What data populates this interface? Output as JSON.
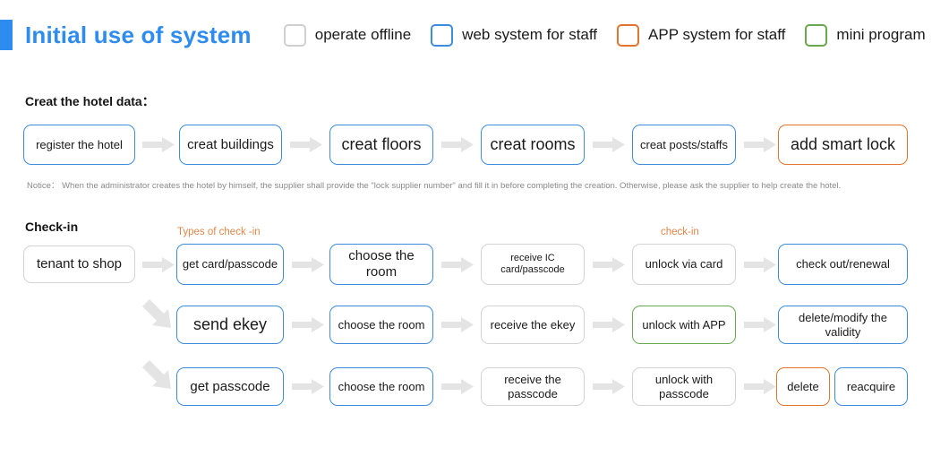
{
  "header": {
    "title": "Initial use of system",
    "accent_color": "#2e8cf0",
    "legend": [
      {
        "label": "operate offline",
        "color": "#cfcfcf",
        "style": "gray"
      },
      {
        "label": "web system for staff",
        "color": "#3d8ddf",
        "style": "blue"
      },
      {
        "label": "APP system for staff",
        "color": "#e2752e",
        "style": "orange"
      },
      {
        "label": "mini program",
        "color": "#6aa84f",
        "style": "green"
      }
    ]
  },
  "sections": {
    "hotel_data": {
      "heading": "Creat the hotel data：",
      "nodes": [
        {
          "label": "register the hotel",
          "style": "blue"
        },
        {
          "label": "creat buildings",
          "style": "blue"
        },
        {
          "label": "creat floors",
          "style": "blue"
        },
        {
          "label": "creat rooms",
          "style": "blue"
        },
        {
          "label": "creat posts/staffs",
          "style": "blue"
        },
        {
          "label": "add smart lock",
          "style": "orange"
        }
      ],
      "notice": "Notice：  When the administrator creates the hotel by himself, the supplier shall provide the \"lock supplier number\" and fill it in before completing the creation. Otherwise, please ask the supplier to help create the hotel."
    },
    "check_in": {
      "heading": "Check-in",
      "captions": {
        "types": "Types of check -in",
        "checkin": "check-in"
      },
      "start_node": {
        "label": "tenant to shop",
        "style": "gray"
      },
      "rows": [
        {
          "nodes": [
            {
              "label": "get card/passcode",
              "style": "blue"
            },
            {
              "label": "choose the room",
              "style": "blue"
            },
            {
              "label": "receive IC card/passcode",
              "style": "gray"
            },
            {
              "label": "unlock via card",
              "style": "gray"
            },
            {
              "label": "check out/renewal",
              "style": "blue"
            }
          ]
        },
        {
          "nodes": [
            {
              "label": "send ekey",
              "style": "blue"
            },
            {
              "label": "choose the room",
              "style": "blue"
            },
            {
              "label": "receive the ekey",
              "style": "gray"
            },
            {
              "label": "unlock with APP",
              "style": "green"
            },
            {
              "label": "delete/modify the validity",
              "style": "blue"
            }
          ]
        },
        {
          "nodes": [
            {
              "label": "get passcode",
              "style": "blue"
            },
            {
              "label": "choose the room",
              "style": "blue"
            },
            {
              "label": "receive the passcode",
              "style": "gray"
            },
            {
              "label": "unlock with passcode",
              "style": "gray"
            },
            {
              "label": "delete",
              "style": "orange"
            },
            {
              "label": "reacquire",
              "style": "blue"
            }
          ]
        }
      ]
    }
  }
}
